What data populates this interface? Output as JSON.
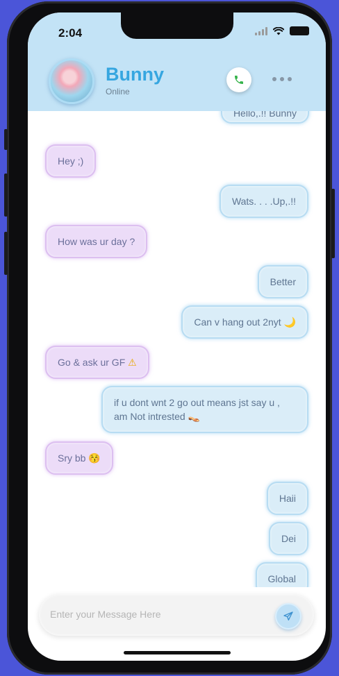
{
  "status_bar": {
    "time": "2:04"
  },
  "header": {
    "contact_name": "Bunny",
    "contact_status": "Online"
  },
  "chat": {
    "messages": [
      {
        "side": "out",
        "text": "Hello,.!! Bunny"
      },
      {
        "side": "in",
        "text": "Hey ;)"
      },
      {
        "side": "out",
        "text": "Wats. . . .Up,.!!"
      },
      {
        "side": "in",
        "text": "How was ur day ?"
      },
      {
        "side": "out",
        "text": "Better"
      },
      {
        "side": "out",
        "text": "Can v hang out 2nyt",
        "emoji": "🌙"
      },
      {
        "side": "in",
        "text": "Go & ask ur GF",
        "emoji": "⚠"
      },
      {
        "side": "out",
        "text": "if u dont wnt 2 go out means jst say u , am Not intrested",
        "emoji": "👡"
      },
      {
        "side": "in",
        "text": "Sry bb",
        "emoji": "😚"
      },
      {
        "side": "out",
        "text": "Haii"
      },
      {
        "side": "out",
        "text": "Dei"
      },
      {
        "side": "out",
        "text": "Global"
      }
    ]
  },
  "composer": {
    "placeholder": "Enter your Message Here"
  },
  "colors": {
    "header_bg": "#c3e3f6",
    "accent": "#36a6e0",
    "incoming_bubble": "#ecdcf8",
    "outgoing_bubble": "#daedf8",
    "call_icon": "#35b34a",
    "app_background": "#4b55d8"
  },
  "icons": [
    "signal-icon",
    "wifi-icon",
    "battery-icon",
    "phone-icon",
    "more-icon",
    "send-icon"
  ]
}
